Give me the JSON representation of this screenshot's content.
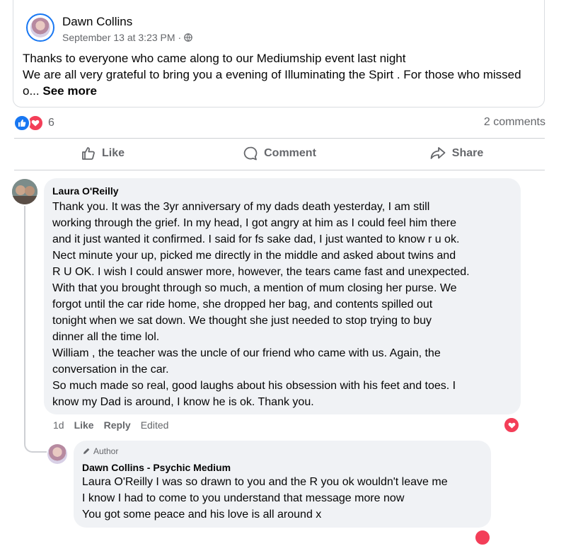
{
  "post": {
    "author": "Dawn Collins",
    "date": "September 13 at 3:23 PM",
    "separator": "·",
    "text": "Thanks to everyone who came along to our Mediumship  event last night\nWe are all very grateful to bring you a evening of Illuminating the Spirt . For those who missed o...",
    "see_more": "See more",
    "icons": {
      "privacy": "globe-icon",
      "avatar": "avatar"
    }
  },
  "stats": {
    "reaction_count": "6",
    "comments": "2 comments",
    "reaction_icons": [
      "like-icon",
      "love-icon"
    ]
  },
  "actions": {
    "like": "Like",
    "comment": "Comment",
    "share": "Share"
  },
  "comment": {
    "name": "Laura O'Reilly",
    "text": "Thank you. It was the 3yr anniversary of my dads death yesterday, I am still\nworking through the grief. In my head, I got angry at him as I could feel him there\nand it just wanted it confirmed. I said for fs sake dad, I just wanted to know r u ok.\nNect minute your up, picked me directly in the middle and asked about twins and\nR U OK. I wish I could answer more, however, the tears came fast and unexpected.\nWith that you brought through so much, a mention of mum closing her purse. We\nforgot until the car ride home, she dropped her bag, and contents spilled out\ntonight when we sat down. We thought she just needed to stop trying to buy\ndinner all the time lol.\nWilliam , the teacher was the uncle of our friend who came with us. Again, the\nconversation in the car.\nSo much made so real, good laughs about his obsession with his feet and toes. I\nknow my Dad is around, I know he is ok. Thank you.",
    "time": "1d",
    "like": "Like",
    "reply": "Reply",
    "edited": "Edited"
  },
  "reply": {
    "badge": "Author",
    "name": "Dawn Collins - Psychic Medium",
    "text": "Laura O'Reilly I was so drawn to you and the R you ok wouldn't leave me\n I know I had to come to you understand that message more now\n You got some peace and his love is all around x"
  },
  "colors": {
    "accent": "#1877f2",
    "love": "#f33e58",
    "bubble": "#f0f2f5",
    "secondary_text": "#65676b"
  }
}
